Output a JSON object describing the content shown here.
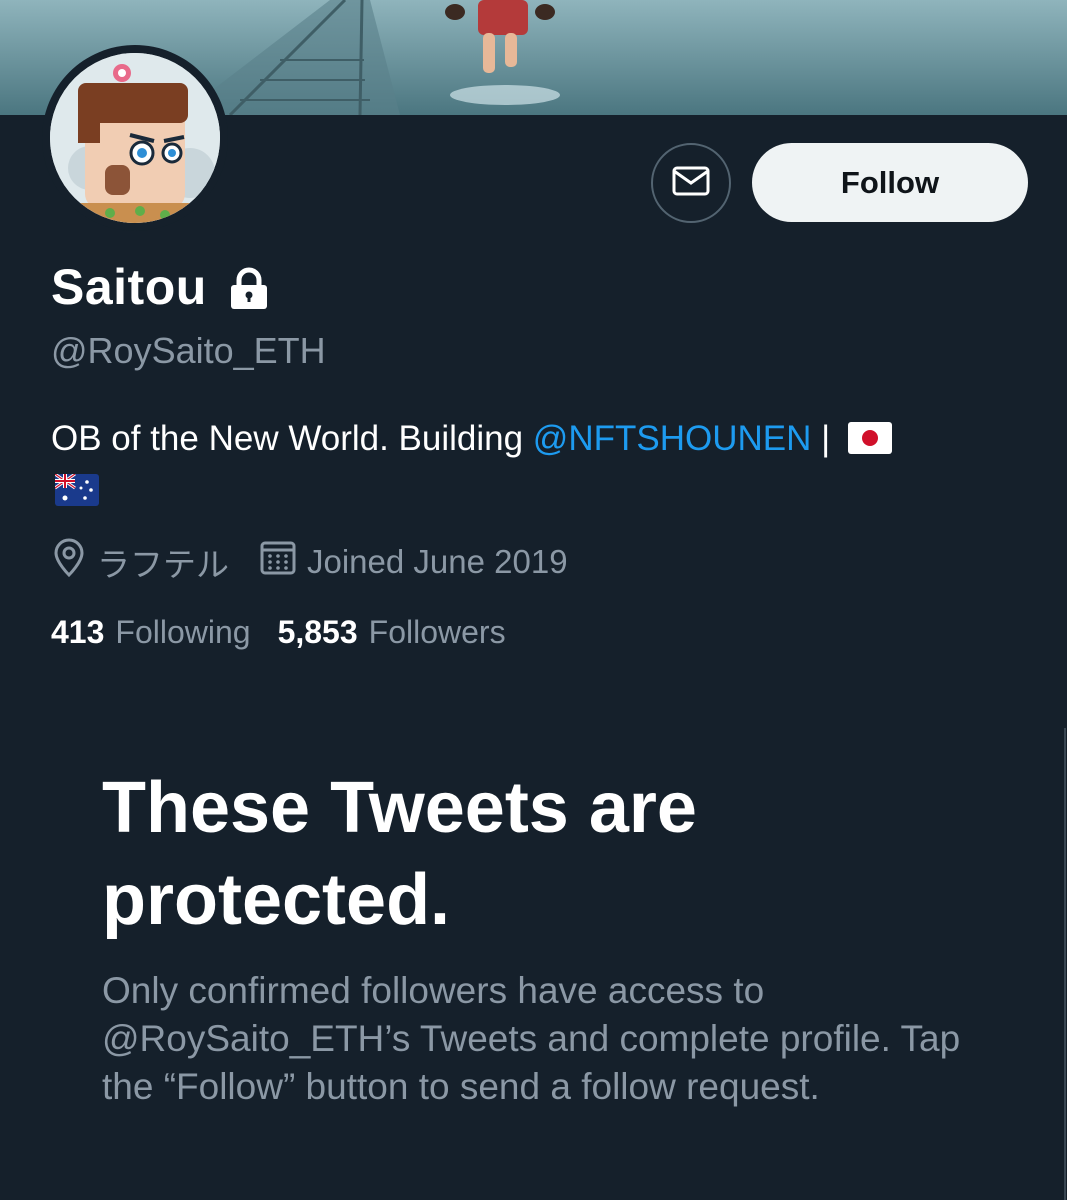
{
  "banner": {
    "description_icon": "header-banner-image"
  },
  "profile": {
    "display_name": "Saitou",
    "handle": "@RoySaito_ETH",
    "protected": true,
    "bio_prefix": "OB of the New World. Building ",
    "bio_mention": "@NFTSHOUNEN",
    "bio_separator": " |",
    "location": "ラフテル",
    "joined": "Joined June 2019"
  },
  "actions": {
    "message_icon": "envelope-icon",
    "follow_label": "Follow"
  },
  "stats": {
    "following_count": "413",
    "following_label": "Following",
    "followers_count": "5,853",
    "followers_label": "Followers"
  },
  "protected_notice": {
    "title": "These Tweets are protected.",
    "description": "Only confirmed followers have access to @RoySaito_ETH’s Tweets and complete profile. Tap the “Follow” button to send a follow request."
  },
  "colors": {
    "background": "#15202b",
    "accent": "#1d9bf0",
    "secondary_text": "#8b98a5",
    "follow_button_bg": "#eff3f4"
  }
}
